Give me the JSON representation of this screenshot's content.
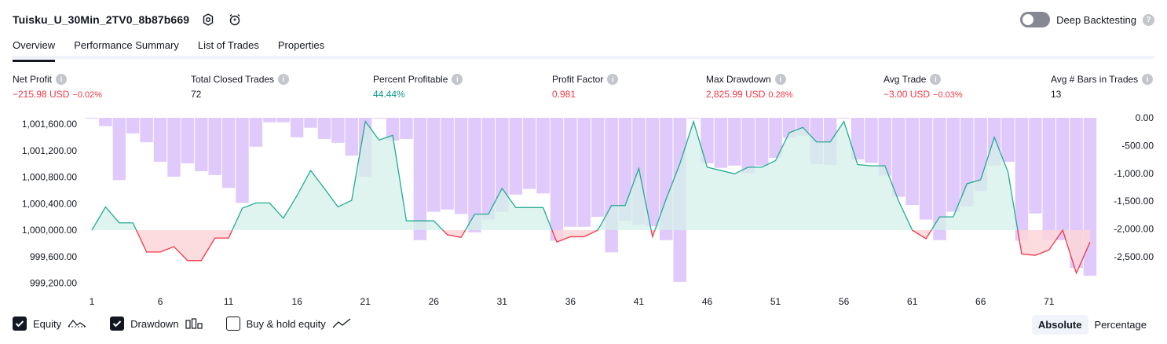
{
  "header": {
    "title": "Tuisku_U_30Min_2TV0_8b87b669",
    "deep_backtesting_label": "Deep Backtesting",
    "deep_backtesting_on": false
  },
  "tabs": [
    {
      "label": "Overview",
      "active": true
    },
    {
      "label": "Performance Summary",
      "active": false
    },
    {
      "label": "List of Trades",
      "active": false
    },
    {
      "label": "Properties",
      "active": false
    }
  ],
  "stats": [
    {
      "label": "Net Profit",
      "value": "−215.98 USD",
      "pct": "−0.02%",
      "color": "red"
    },
    {
      "label": "Total Closed Trades",
      "value": "72",
      "pct": "",
      "color": "dark"
    },
    {
      "label": "Percent Profitable",
      "value": "44.44%",
      "pct": "",
      "color": "green"
    },
    {
      "label": "Profit Factor",
      "value": "0.981",
      "pct": "",
      "color": "red"
    },
    {
      "label": "Max Drawdown",
      "value": "2,825.99 USD",
      "pct": "0.28%",
      "color": "red"
    },
    {
      "label": "Avg Trade",
      "value": "−3.00 USD",
      "pct": "−0.03%",
      "color": "red"
    },
    {
      "label": "Avg # Bars in Trades",
      "value": "13",
      "pct": "",
      "color": "dark"
    }
  ],
  "chart_data": {
    "type": "line",
    "x_ticks": [
      "1",
      "6",
      "11",
      "16",
      "21",
      "26",
      "31",
      "36",
      "41",
      "46",
      "51",
      "56",
      "61",
      "66",
      "71"
    ],
    "y_left_ticks": [
      "1,001,600.00",
      "1,001,200.00",
      "1,000,800.00",
      "1,000,400.00",
      "1,000,000.00",
      "999,600.00",
      "999,200.00"
    ],
    "y_right_ticks": [
      "0.00",
      "-500.00",
      "-1,000.00",
      "-1,500.00",
      "-2,000.00",
      "-2,500.00"
    ],
    "baseline": 1000000,
    "series": [
      {
        "name": "Equity",
        "values": [
          1000000,
          1000350,
          1000110,
          1000110,
          999670,
          999670,
          999750,
          999540,
          999540,
          999880,
          999880,
          1000330,
          1000410,
          1000410,
          1000180,
          1000520,
          1000900,
          1000630,
          1000350,
          1000450,
          1001640,
          1001360,
          1001430,
          1000140,
          1000140,
          1000140,
          999930,
          999890,
          1000240,
          1000240,
          1000630,
          1000340,
          1000340,
          1000340,
          999820,
          999900,
          999900,
          1000000,
          1000370,
          1000370,
          1000930,
          999900,
          1000470,
          1001000,
          1001640,
          1000950,
          1000900,
          1000850,
          1000950,
          1000950,
          1001050,
          1001470,
          1001550,
          1001330,
          1001330,
          1001640,
          1000990,
          1000970,
          1000970,
          1000440,
          1000000,
          999870,
          1000200,
          1000200,
          1000700,
          1000760,
          1001400,
          1000880,
          999640,
          999620,
          999700,
          1000000,
          999350,
          999820
        ]
      },
      {
        "name": "Drawdown",
        "values": [
          -1,
          -150,
          -1120,
          -280,
          -440,
          -790,
          -1060,
          -820,
          -960,
          -1030,
          -1260,
          -1530,
          -520,
          -80,
          -80,
          -350,
          -180,
          -380,
          -450,
          -680,
          -1060,
          -1,
          -410,
          -380,
          -2200,
          -1690,
          -1650,
          -1730,
          -2060,
          -1830,
          -1690,
          -1380,
          -1280,
          -1360,
          -2210,
          -1960,
          -1960,
          -1780,
          -2420,
          -1850,
          -1920,
          -1950,
          -2200,
          -2950,
          -1,
          -820,
          -900,
          -860,
          -1000,
          -860,
          -720,
          -360,
          -320,
          -830,
          -850,
          -1,
          -750,
          -810,
          -1040,
          -1420,
          -1570,
          -1830,
          -2200,
          -1690,
          -1600,
          -1320,
          -860,
          -790,
          -2210,
          -1720,
          -2200,
          -2200,
          -2700,
          -2840
        ]
      }
    ],
    "ylim": [
      999100,
      1001700
    ],
    "drawdown_ylim": [
      -3000,
      0
    ],
    "legend": [
      {
        "label": "Equity",
        "checked": true,
        "icon": "equity-line-icon"
      },
      {
        "label": "Drawdown",
        "checked": true,
        "icon": "drawdown-bars-icon"
      },
      {
        "label": "Buy & hold equity",
        "checked": false,
        "icon": "buy-hold-line-icon"
      }
    ],
    "colors": {
      "equity_line_up": "#22ab94",
      "equity_line_down": "#f23645",
      "equity_fill_up": "#d6f0ea",
      "equity_fill_down": "#fcd6d9",
      "drawdown_bar": "#ddc3fb",
      "overlap_line": "#2962ff"
    }
  },
  "footer": {
    "modes": [
      {
        "label": "Absolute",
        "active": true
      },
      {
        "label": "Percentage",
        "active": false
      }
    ]
  }
}
